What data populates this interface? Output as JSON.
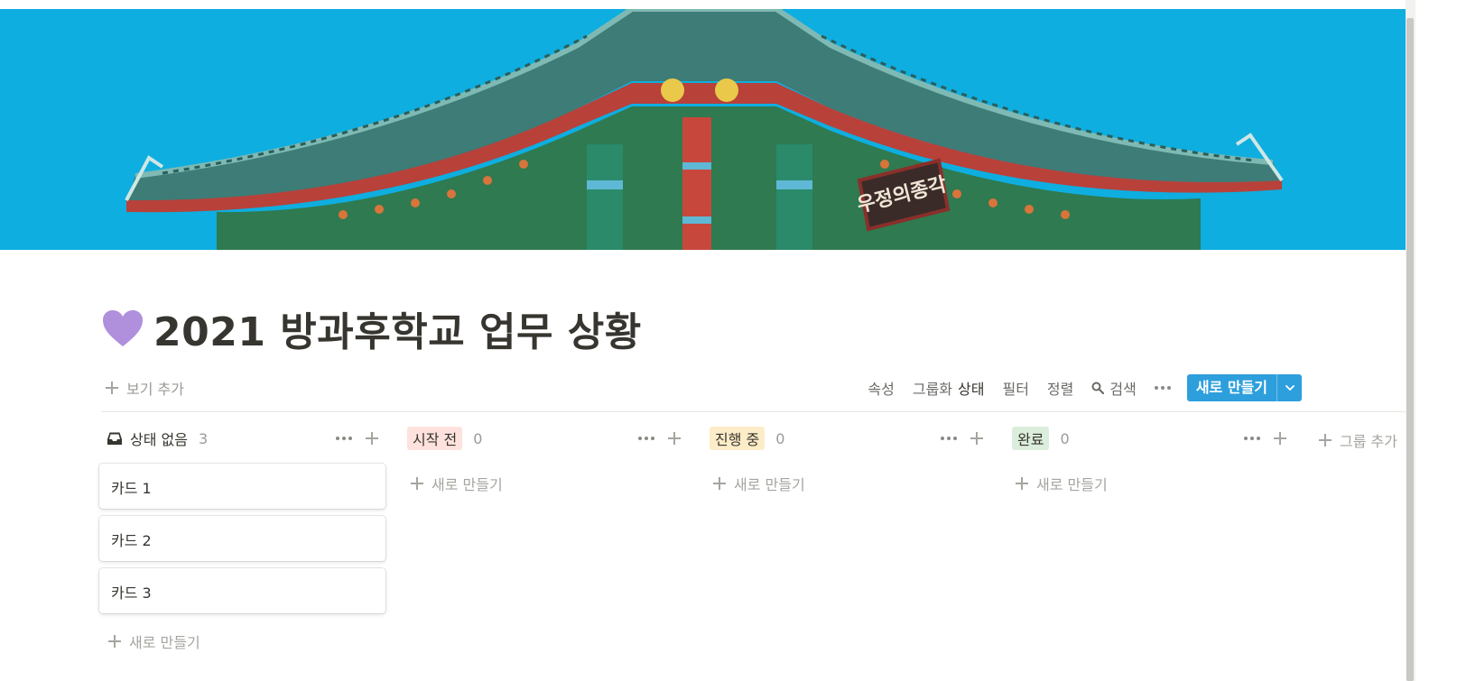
{
  "page": {
    "title": "2021 방과후학교 업무 상황",
    "icon": "purple-heart-icon"
  },
  "cover": {
    "sign_text": "우정의종각"
  },
  "toolbar": {
    "add_view": "보기 추가",
    "properties": "속성",
    "group_by": "그룹화",
    "group_by_value": "상태",
    "filter": "필터",
    "sort": "정렬",
    "search": "검색",
    "new": "새로 만들기"
  },
  "board": {
    "columns": [
      {
        "label": "상태 없음",
        "count": "3",
        "color": ""
      },
      {
        "label": "시작 전",
        "count": "0",
        "color": "#ffe2dd"
      },
      {
        "label": "진행 중",
        "count": "0",
        "color": "#fdecc8"
      },
      {
        "label": "완료",
        "count": "0",
        "color": "#dbeddb"
      }
    ],
    "cards": [
      "카드 1",
      "카드 2",
      "카드 3"
    ],
    "new_item": "새로 만들기",
    "add_group": "그룹 추가"
  },
  "colors": {
    "accent": "#2e9fdd",
    "cover_sky": "#0eaee0",
    "heart": "#b08fdd"
  }
}
